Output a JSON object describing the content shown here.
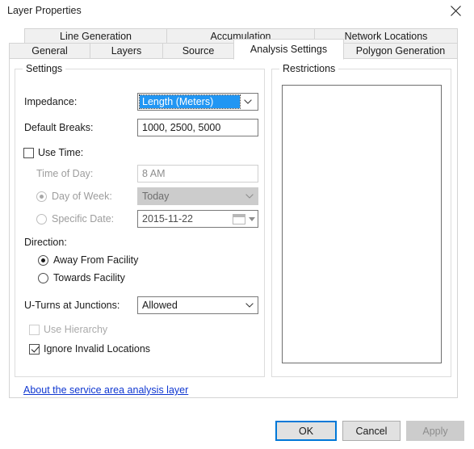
{
  "window": {
    "title": "Layer Properties",
    "close_icon": "close-icon"
  },
  "tabs": {
    "row1": [
      {
        "label": "Line Generation",
        "selected": false
      },
      {
        "label": "Accumulation",
        "selected": false
      },
      {
        "label": "Network Locations",
        "selected": false
      }
    ],
    "row2": [
      {
        "label": "General",
        "selected": false
      },
      {
        "label": "Layers",
        "selected": false
      },
      {
        "label": "Source",
        "selected": false
      },
      {
        "label": "Analysis Settings",
        "selected": true
      },
      {
        "label": "Polygon Generation",
        "selected": false
      }
    ]
  },
  "settings": {
    "group_title": "Settings",
    "impedance": {
      "label": "Impedance:",
      "value": "Length (Meters)",
      "highlight_color": "#2196f3",
      "focused": true
    },
    "default_breaks": {
      "label": "Default Breaks:",
      "value": "1000, 2500, 5000"
    },
    "use_time": {
      "label": "Use Time:",
      "checked": false
    },
    "time_of_day": {
      "label": "Time of Day:",
      "value": "8 AM",
      "enabled": false
    },
    "day_of_week": {
      "label": "Day of Week:",
      "value": "Today",
      "selected": true,
      "enabled": false
    },
    "specific_date": {
      "label": "Specific Date:",
      "value": "2015-11-22",
      "selected": false,
      "enabled": false,
      "calendar_icon": "calendar-icon"
    },
    "direction": {
      "label": "Direction:",
      "options": [
        {
          "label": "Away From Facility",
          "selected": true
        },
        {
          "label": "Towards Facility",
          "selected": false
        }
      ]
    },
    "u_turns": {
      "label": "U-Turns at Junctions:",
      "value": "Allowed"
    },
    "use_hierarchy": {
      "label": "Use Hierarchy",
      "checked": false,
      "enabled": false
    },
    "ignore_invalid": {
      "label": "Ignore Invalid Locations",
      "checked": true,
      "enabled": true
    }
  },
  "restrictions": {
    "group_title": "Restrictions",
    "items": []
  },
  "help_link": {
    "label": "About the service area analysis layer",
    "color": "#0f37d1"
  },
  "buttons": {
    "ok": {
      "label": "OK",
      "default": true,
      "enabled": true
    },
    "cancel": {
      "label": "Cancel",
      "enabled": true
    },
    "apply": {
      "label": "Apply",
      "enabled": false
    }
  }
}
